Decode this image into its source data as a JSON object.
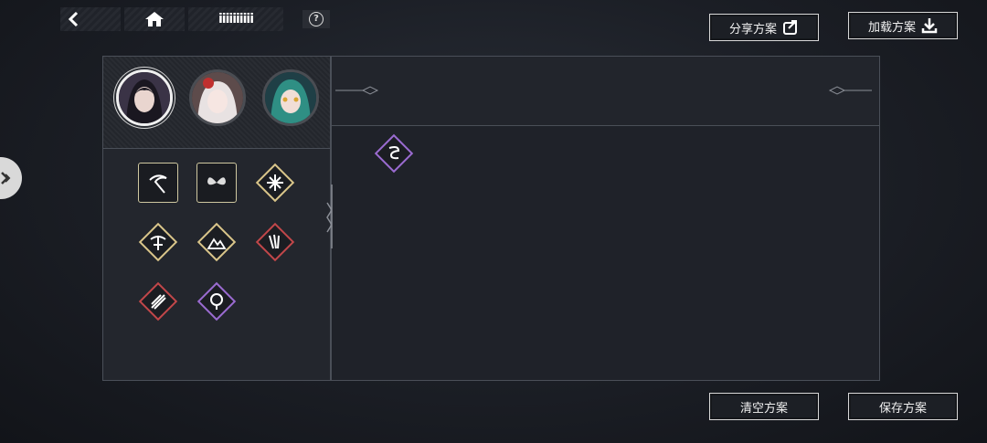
{
  "topbar": {
    "back_icon": "back-arrow-icon",
    "home_icon": "home-icon",
    "profile_name": "iiiiiiiiii",
    "help_label": "?"
  },
  "buttons": {
    "share": "分享方案",
    "load": "加载方案",
    "clear": "清空方案",
    "save": "保存方案"
  },
  "characters": [
    {
      "id": "char-1",
      "selected": true
    },
    {
      "id": "char-2",
      "selected": false
    },
    {
      "id": "char-3",
      "selected": false
    }
  ],
  "skills": [
    {
      "id": "skill-1",
      "frame": "square",
      "icon": "scythe-icon"
    },
    {
      "id": "skill-2",
      "frame": "square",
      "icon": "butterfly-icon"
    },
    {
      "id": "skill-3",
      "frame": "gold",
      "icon": "burst-icon"
    },
    {
      "id": "skill-4",
      "frame": "gold",
      "icon": "crossbow-icon"
    },
    {
      "id": "skill-5",
      "frame": "gold",
      "icon": "mountain-icon"
    },
    {
      "id": "skill-6",
      "frame": "red",
      "icon": "claws-icon"
    },
    {
      "id": "skill-7",
      "frame": "red",
      "icon": "slash-icon"
    },
    {
      "id": "skill-8",
      "frame": "purple",
      "icon": "orb-icon"
    }
  ],
  "equipped_slot": {
    "frame": "purple",
    "icon": "dragon-icon"
  },
  "colors": {
    "gold": "#d9c58a",
    "red": "#c0474a",
    "purple": "#9a6bd0",
    "bg": "#1b1e25"
  }
}
